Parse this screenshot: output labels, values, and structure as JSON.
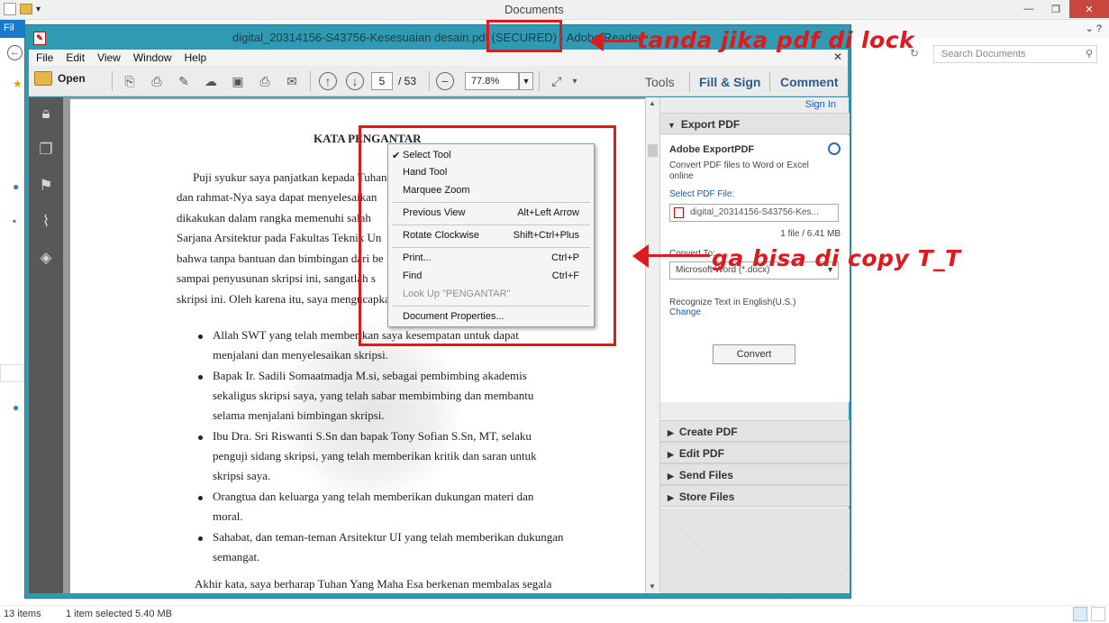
{
  "explorer": {
    "title": "Documents",
    "file_tab": "Fil",
    "search_placeholder": "Search Documents",
    "status_count": "13 items",
    "status_selected": "1 item selected  5.40 MB"
  },
  "reader": {
    "window_title": "digital_20314156-S43756-Kesesuaian desain.pdf (SECURED) - Adobe Reader",
    "menu": [
      "File",
      "Edit",
      "View",
      "Window",
      "Help"
    ],
    "toolbar": {
      "open_label": "Open",
      "page_current": "5",
      "page_total": "/ 53",
      "zoom": "77.8%",
      "tools_label": "Tools",
      "fill_sign_label": "Fill & Sign",
      "comment_label": "Comment"
    }
  },
  "document": {
    "heading": "KATA PENGANTAR",
    "paragraph_lines": [
      "Puji syukur saya panjatkan kepada Tuhan",
      "dan rahmat-Nya saya dapat menyelesaikan",
      "dikakukan dalam rangka memenuhi salah",
      "Sarjana Arsitektur pada Fakultas Teknik Un",
      "bahwa tanpa bantuan dan bimbingan dari be",
      "sampai penyusunan skripsi ini, sangatlah s",
      "skripsi ini. Oleh karena itu, saya mengucapka"
    ],
    "bullets": [
      [
        "Allah SWT yang telah memberikan saya kesempatan untuk dapat",
        "menjalani dan menyelesaikan skripsi."
      ],
      [
        "Bapak Ir. Sadili Somaatmadja M.si, sebagai pembimbing akademis",
        "sekaligus skripsi saya, yang telah sabar membimbing dan membantu",
        "selama menjalani bimbingan skripsi."
      ],
      [
        "Ibu Dra. Sri Riswanti S.Sn dan bapak Tony Sofian S.Sn, MT, selaku",
        "penguji sidang skripsi, yang telah memberikan kritik dan saran untuk",
        "skripsi saya."
      ],
      [
        "Orangtua dan keluarga yang telah memberikan dukungan materi dan",
        "moral."
      ],
      [
        "Sahabat, dan teman-teman Arsitektur UI yang telah memberikan dukungan",
        "semangat."
      ]
    ],
    "closing_line": "Akhir kata, saya berharap Tuhan Yang Maha Esa berkenan membalas segala"
  },
  "context_menu": {
    "items": [
      {
        "label": "Select Tool",
        "shortcut": "",
        "checked": true
      },
      {
        "label": "Hand Tool",
        "shortcut": ""
      },
      {
        "label": "Marquee Zoom",
        "shortcut": ""
      },
      {
        "label": "Previous View",
        "shortcut": "Alt+Left Arrow"
      },
      {
        "label": "Rotate Clockwise",
        "shortcut": "Shift+Ctrl+Plus"
      },
      {
        "label": "Print...",
        "shortcut": "Ctrl+P"
      },
      {
        "label": "Find",
        "shortcut": "Ctrl+F"
      },
      {
        "label": "Look Up \"PENGANTAR\"",
        "shortcut": "",
        "disabled": true
      },
      {
        "label": "Document Properties...",
        "shortcut": ""
      }
    ]
  },
  "right_panel": {
    "sign_in": "Sign In",
    "export_section": "Export PDF",
    "export_title": "Adobe ExportPDF",
    "export_desc": [
      "Convert PDF files to Word or Excel",
      "online"
    ],
    "select_pdf": "Select PDF File:",
    "file_name": "digital_20314156-S43756-Kes...",
    "file_count": "1 file / 6.41 MB",
    "convert_to": "Convert To:",
    "convert_format": "Microsoft Word (*.docx)",
    "recognize": "Recognize Text in English(U.S.)",
    "change": "Change",
    "convert_button": "Convert",
    "sections": [
      "Create PDF",
      "Edit PDF",
      "Send Files",
      "Store Files"
    ]
  },
  "annotations": {
    "locked_note": "tanda jika pdf di lock",
    "copy_note": "ga bisa di copy T_T",
    "color": "#e0191e"
  }
}
